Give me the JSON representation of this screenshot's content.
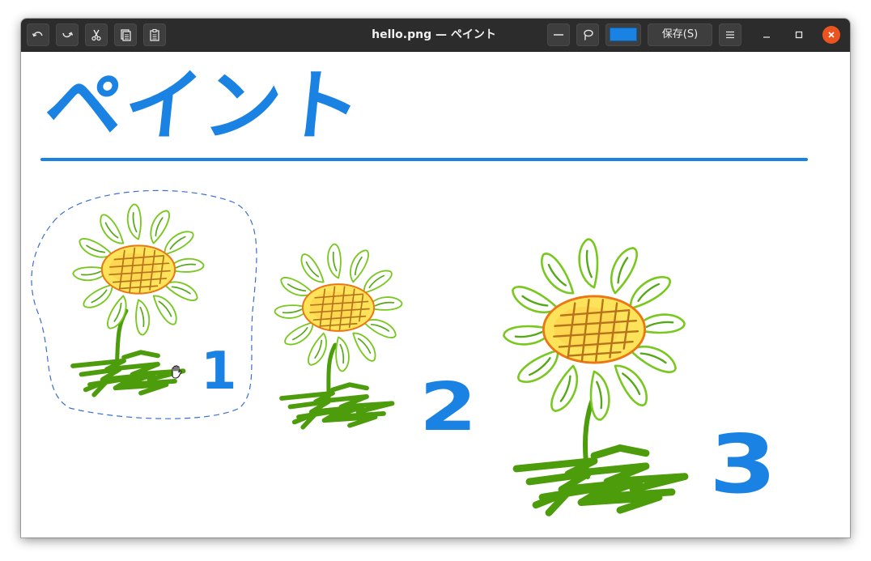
{
  "window": {
    "title": "hello.png — ペイント"
  },
  "toolbar": {
    "undo_icon": "undo-icon",
    "redo_icon": "redo-icon",
    "cut_icon": "scissors-icon",
    "copy_icon": "copy-icon",
    "paste_icon": "clipboard-icon",
    "line_tool_icon": "line-icon",
    "lasso_tool_icon": "lasso-icon",
    "current_color": "#1a82e2",
    "save_label": "保存(S)",
    "menu_icon": "hamburger-menu-icon"
  },
  "window_controls": {
    "minimize_icon": "minimize-icon",
    "maximize_icon": "maximize-icon",
    "close_icon": "close-icon",
    "close_color": "#e95420"
  },
  "canvas": {
    "heading_text": "ペイント",
    "accent_color": "#1a82e2",
    "labels": [
      "1",
      "2",
      "3"
    ],
    "cursor_icon": "grab-hand-icon"
  }
}
